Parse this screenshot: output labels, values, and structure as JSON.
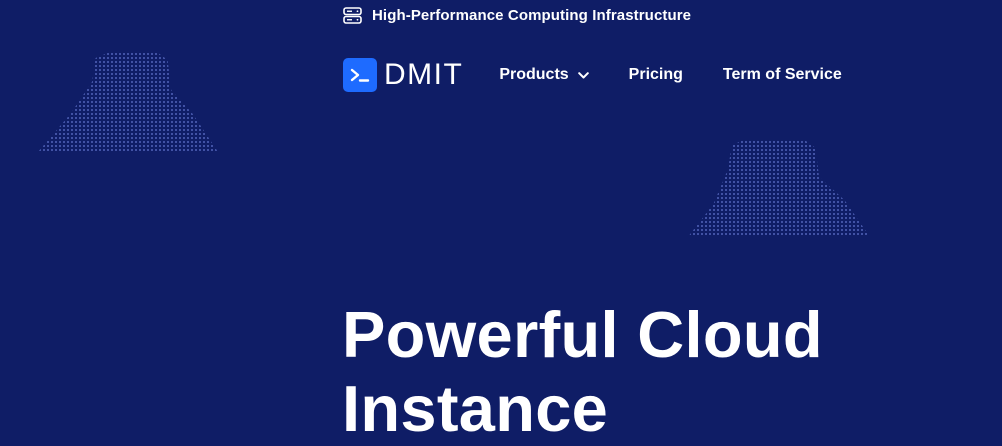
{
  "topbar": {
    "icon": "server-icon",
    "tagline": "High-Performance Computing Infrastructure"
  },
  "logo": {
    "icon": "terminal-prompt-icon",
    "text": "DMIT",
    "accent_color": "#1e6bff"
  },
  "nav": {
    "items": [
      {
        "label": "Products",
        "icon": "chevron-down-icon"
      },
      {
        "label": "Pricing"
      },
      {
        "label": "Term of Service"
      }
    ]
  },
  "hero": {
    "title_line1": "Powerful Cloud",
    "title_line2": "Instance"
  },
  "colors": {
    "background": "#0f1d66",
    "text": "#ffffff",
    "dot_pattern": "#788ceb"
  }
}
